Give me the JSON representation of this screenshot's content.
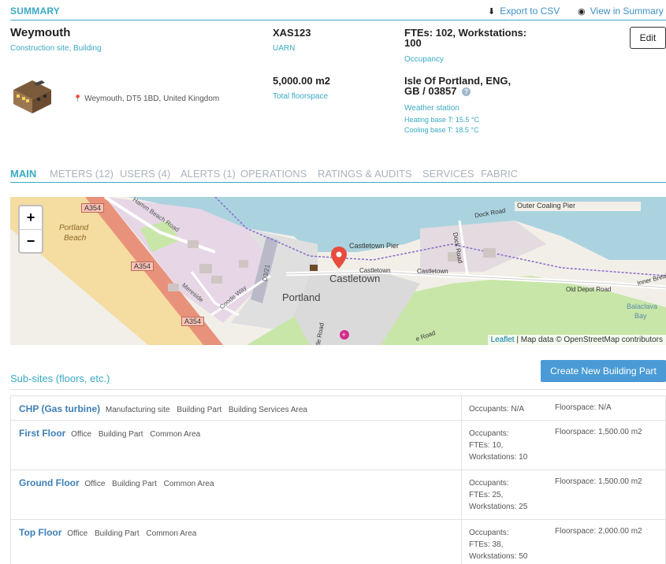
{
  "header": {
    "title": "SUMMARY",
    "export_label": "Export to CSV",
    "view_label": "View in Summary"
  },
  "site": {
    "name": "Weymouth",
    "type": "Construction site, Building",
    "address": "Weymouth, DT5 1BD, United Kingdom",
    "uarn_value": "XAS123",
    "uarn_label": "UARN",
    "floorspace_value": "5,000.00 m2",
    "floorspace_label": "Total floorspace",
    "occupancy_line1": "FTEs: 102, Workstations:",
    "occupancy_line2": "100",
    "occupancy_label": "Occupancy",
    "weather_line1": "Isle Of Portland, ENG,",
    "weather_line2": "GB / 03857",
    "weather_label": "Weather station",
    "heating_base": "Heating base T: 15.5 °C",
    "cooling_base": "Cooling base T: 18.5 °C",
    "edit_label": "Edit"
  },
  "tabs": [
    {
      "label": "MAIN"
    },
    {
      "label": "METERS (12)"
    },
    {
      "label": "USERS (4)"
    },
    {
      "label": "ALERTS (1)"
    },
    {
      "label": "OPERATIONS"
    },
    {
      "label": "RATINGS & AUDITS"
    },
    {
      "label": "SERVICES"
    },
    {
      "label": "FABRIC"
    }
  ],
  "map": {
    "zoom_in": "+",
    "zoom_out": "−",
    "attribution_link": "Leaflet",
    "attribution_text": " | Map data © OpenStreetMap contributors",
    "labels": {
      "outer_pier": "Outer Coaling Pier",
      "dock_road": "Dock Road",
      "dock_road2": "Dock Road",
      "portland_beach1": "Portland",
      "portland_beach2": "Beach",
      "a354_1": "A354",
      "a354_2": "A354",
      "a354_3": "A354",
      "hamm_beach": "Hamm Beach Road",
      "meresde": "Mereside",
      "coode_way": "Coode Way",
      "castletown_pier": "Castletown Pier",
      "castletown_road1": "Castletown",
      "castletown_road2": "Castletown",
      "castletown_big": "Castletown",
      "portland": "Portland",
      "old_depot": "Old Depot Road",
      "inner_break": "Inner Break",
      "balaclava1": "Balaclava",
      "balaclava2": "Bay",
      "d321": "D3/21",
      "tle_road": "tle Road",
      "e_road": "e Road"
    }
  },
  "subsites": {
    "title": "Sub-sites (floors, etc.)",
    "create_label": "Create New Building Part",
    "rows": [
      {
        "name": "CHP (Gas turbine)",
        "type": "Manufacturing site",
        "kind": "Building Part",
        "area": "Building Services Area",
        "occ1": "Occupants: N/A",
        "occ2": "",
        "occ3": "",
        "floor": "Floorspace: N/A"
      },
      {
        "name": "First Floor",
        "type": "Office",
        "kind": "Building Part",
        "area": "Common Area",
        "occ1": "Occupants:",
        "occ2": "FTEs: 10,",
        "occ3": "Workstations: 10",
        "floor": "Floorspace: 1,500.00 m2"
      },
      {
        "name": "Ground Floor",
        "type": "Office",
        "kind": "Building Part",
        "area": "Common Area",
        "occ1": "Occupants:",
        "occ2": "FTEs: 25,",
        "occ3": "Workstations: 25",
        "floor": "Floorspace: 1,500.00 m2"
      },
      {
        "name": "Top Floor",
        "type": "Office",
        "kind": "Building Part",
        "area": "Common Area",
        "occ1": "Occupants:",
        "occ2": "FTEs: 38,",
        "occ3": "Workstations: 50",
        "floor": "Floorspace: 2,000.00 m2"
      }
    ]
  },
  "colors": {
    "accent": "#3aa9c3",
    "link": "#3d7fb5",
    "button": "#4a9bd5",
    "water": "#aad3df",
    "beach": "#f5dca0",
    "road_a": "#e8927c",
    "park": "#c8e6a8",
    "residential": "#e6d6e6",
    "industrial": "#e3dbe0",
    "marker": "#e74c3c"
  },
  "icons": {
    "export": "download-icon",
    "view": "eye-icon",
    "address": "map-pin-icon",
    "help": "question-circle-icon",
    "building": "building-icon"
  }
}
